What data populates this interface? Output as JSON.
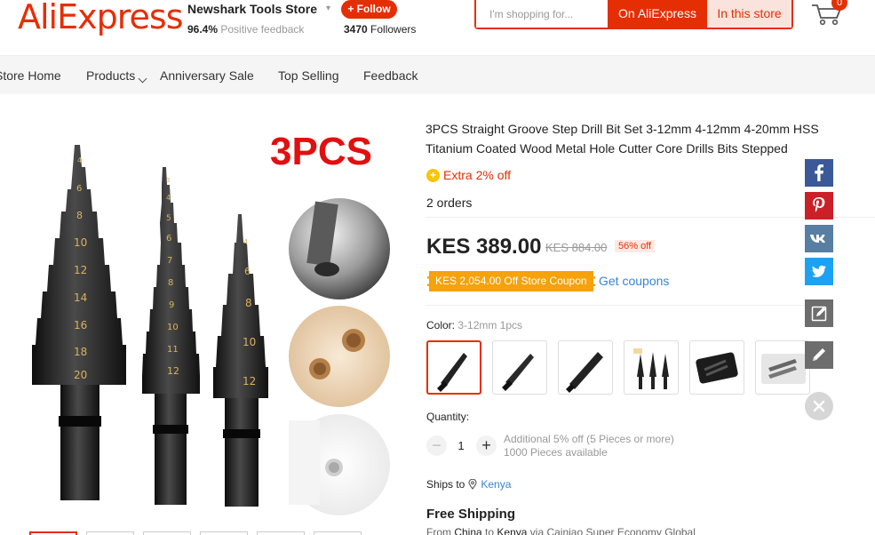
{
  "header": {
    "logo": "AliExpress",
    "store_name": "Newshark Tools Store",
    "follow_label": "+ Follow",
    "feedback_percent": "96.4%",
    "feedback_label": "Positive feedback",
    "followers_count": "3470",
    "followers_label": "Followers",
    "search_placeholder": "I'm shopping for...",
    "search_aliexpress": "On AliExpress",
    "search_store": "In this store",
    "cart_count": "0"
  },
  "nav": {
    "items": [
      "Store Home",
      "Products",
      "Anniversary Sale",
      "Top Selling",
      "Feedback"
    ]
  },
  "gallery": {
    "overlay_text": "3PCS",
    "drill_steps": {
      "large": [
        "4",
        "6",
        "8",
        "10",
        "12",
        "14",
        "16",
        "18",
        "20"
      ],
      "medium": [
        "3",
        "4",
        "5",
        "6",
        "7",
        "8",
        "9",
        "10",
        "11",
        "12"
      ],
      "small": [
        "4",
        "6",
        "8",
        "10",
        "12"
      ]
    }
  },
  "product": {
    "title": "3PCS Straight Groove Step Drill Bit Set 3-12mm 4-12mm 4-20mm HSS Titanium Coated Wood Metal Hole Cutter Core Drills Bits Stepped",
    "extra_off": "Extra 2% off",
    "orders": "2 orders",
    "price": "KES 389.00",
    "original_price": "KES 884.00",
    "discount": "56% off",
    "coupon": "KES 2,054.00 Off Store Coupon",
    "get_coupons": "Get coupons",
    "color_label": "Color:",
    "color_value": "3-12mm 1pcs",
    "quantity_label": "Quantity:",
    "quantity_value": "1",
    "quantity_note_1": "Additional 5% off (5 Pieces or more)",
    "quantity_note_2": "1000 Pieces available",
    "ships_to_label": "Ships to",
    "ships_to_country": "Kenya",
    "free_shipping": "Free Shipping",
    "ship_from_label": "From",
    "ship_from": "China",
    "ship_to_word": "to",
    "ship_to": "Kenya",
    "ship_via": "via Cainiao Super Economy Global"
  },
  "social": [
    "facebook",
    "pinterest",
    "vk",
    "twitter",
    "edit",
    "pencil"
  ],
  "colors": {
    "brand": "#e62e04",
    "link": "#3586d6",
    "coupon": "#f5a20b"
  }
}
